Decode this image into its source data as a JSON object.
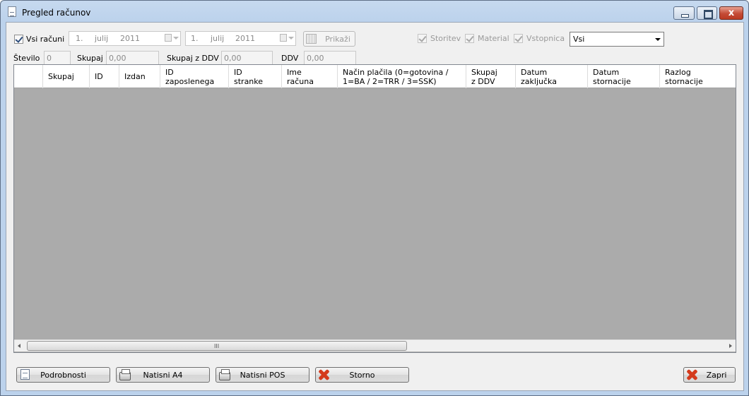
{
  "window": {
    "title": "Pregled računov",
    "close_glyph": "x"
  },
  "filters": {
    "all_invoices_label": "Vsi računi",
    "date_from": {
      "day": "1.",
      "month": "julij",
      "year": "2011"
    },
    "date_to": {
      "day": "1.",
      "month": "julij",
      "year": "2011"
    },
    "show_button": "Prikaži",
    "services_label": "Storitev",
    "material_label": "Material",
    "entrance_label": "Vstopnica",
    "type_select_value": "Vsi"
  },
  "totals": {
    "count_label": "Število",
    "count_value": "0",
    "total_label": "Skupaj",
    "total_value": "0,00",
    "total_vat_label": "Skupaj z DDV",
    "total_vat_value": "0,00",
    "vat_label": "DDV",
    "vat_value": "0,00"
  },
  "grid": {
    "columns": [
      "Skupaj",
      "ID",
      "Izdan",
      "ID\nzaposlenega",
      "ID\nstranke",
      "Ime\nračuna",
      "Način plačila (0=gotovina /\n1=BA / 2=TRR / 3=SSK)",
      "Skupaj\nz DDV",
      "Datum\nzaključka",
      "Datum\nstornacije",
      "Razlog\nstornacije"
    ],
    "rows": [],
    "scroll_grip": "III"
  },
  "buttons": {
    "details": "Podrobnosti",
    "print_a4": "Natisni A4",
    "print_pos": "Natisni POS",
    "cancel": "Storno",
    "close": "Zapri"
  }
}
